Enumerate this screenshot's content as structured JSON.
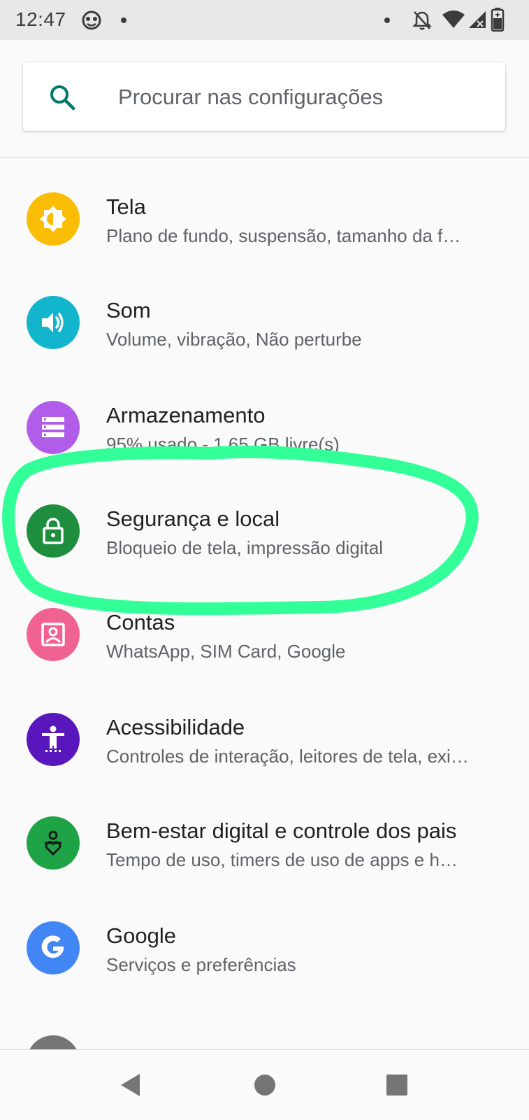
{
  "status_bar": {
    "time": "12:47"
  },
  "search": {
    "placeholder": "Procurar nas configurações"
  },
  "settings": {
    "items": [
      {
        "title": "Tela",
        "subtitle": "Plano de fundo, suspensão, tamanho da f…",
        "icon": "brightness-icon",
        "color": "#fbbc04"
      },
      {
        "title": "Som",
        "subtitle": "Volume, vibração, Não perturbe",
        "icon": "volume-icon",
        "color": "#12b5cb"
      },
      {
        "title": "Armazenamento",
        "subtitle": "95% usado - 1,65 GB livre(s)",
        "icon": "storage-icon",
        "color": "#b15dea"
      },
      {
        "title": "Segurança e local",
        "subtitle": "Bloqueio de tela, impressão digital",
        "icon": "lock-icon",
        "color": "#1e8e3e"
      },
      {
        "title": "Contas",
        "subtitle": "WhatsApp, SIM Card, Google",
        "icon": "account-icon",
        "color": "#f06292"
      },
      {
        "title": "Acessibilidade",
        "subtitle": "Controles de interação, leitores de tela, exi…",
        "icon": "accessibility-icon",
        "color": "#5a16bd"
      },
      {
        "title": "Bem-estar digital e controle dos pais",
        "subtitle": "Tempo de uso, timers de uso de apps e h…",
        "icon": "wellbeing-icon",
        "color": "#1ea446"
      },
      {
        "title": "Google",
        "subtitle": "Serviços e preferências",
        "icon": "google-icon",
        "color": "#4285f4"
      }
    ]
  },
  "annotation": {
    "highlight_color": "#33ff99"
  }
}
